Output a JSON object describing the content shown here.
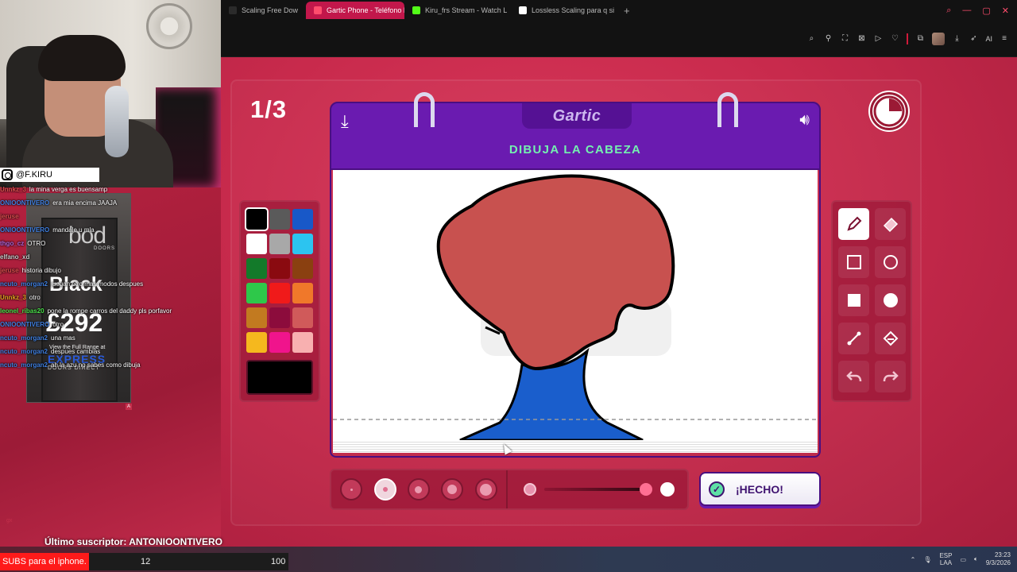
{
  "browser": {
    "tabs": [
      {
        "label": "Scaling Free Dow",
        "active": false,
        "icon": "page-icon",
        "color": "#2b2b2b"
      },
      {
        "label": "Gartic Phone - Teléfono D",
        "active": true,
        "icon": "phone-icon",
        "color": "#ff4d6d"
      },
      {
        "label": "Kiru_frs Stream - Watch L",
        "active": false,
        "icon": "kick-icon",
        "color": "#53fc18"
      },
      {
        "label": "Lossless Scaling para q si",
        "active": false,
        "icon": "google-icon",
        "color": "#ffffff"
      }
    ],
    "toolbar_ai": "AI"
  },
  "game": {
    "round": "1/3",
    "logo": "Gartic",
    "instruction": "DIBUJA LA CABEZA",
    "done_label": "¡HECHO!",
    "timer_elapsed_fraction": 0.25,
    "palette": [
      "#000000",
      "#5a5a5a",
      "#1858c8",
      "#ffffff",
      "#a8a8a8",
      "#2cc4f0",
      "#137a2a",
      "#8a0a10",
      "#8a4010",
      "#2ec84a",
      "#f01a1a",
      "#f0782a",
      "#c27a20",
      "#8c0c3c",
      "#d05a5a",
      "#f5b81e",
      "#f0148c",
      "#f8b0b0"
    ],
    "selected_color": "#000000",
    "brush_sizes": 5,
    "selected_brush": 2,
    "tools": [
      "pen-icon",
      "eraser-icon",
      "rect-outline-icon",
      "circle-outline-icon",
      "rect-fill-icon",
      "circle-fill-icon",
      "line-icon",
      "bucket-icon",
      "undo-icon",
      "redo-icon"
    ],
    "selected_tool": "pen-icon",
    "opacity_fraction": 1.0
  },
  "stream": {
    "social_handle": "@F.KIRU",
    "ad": {
      "brand": "bod",
      "brand_sub": "DOORS",
      "headline": "Black",
      "price": "£292",
      "range": "View the Full Range at",
      "express": "EXPRESS",
      "direct": "DOORS DIRECT",
      "tag": "A"
    },
    "chat": [
      {
        "user": "Unnkz_3",
        "msg": "la mina verga es buensamp",
        "color": "#e05050"
      },
      {
        "user": "ONIOONTIVERO",
        "msg": "era mia encima JAAJA",
        "color": "#3f7fe0"
      },
      {
        "user": "jeruse",
        "msg": "",
        "color": "#e05050"
      },
      {
        "user": "ONIOONTIVERO",
        "msg": "mandale u mla",
        "color": "#3f7fe0"
      },
      {
        "user": "thgo_cz",
        "msg": "OTRO",
        "color": "#b065d8"
      },
      {
        "user": "elfano_xd",
        "msg": "",
        "color": "#c9c9c9"
      },
      {
        "user": "jeruse",
        "msg": "historia dibujo",
        "color": "#e05050"
      },
      {
        "user": "ncuto_morgan2",
        "msg": "juegan otro mas modos despues",
        "color": "#3f7fe0"
      },
      {
        "user": "Unnkz_3",
        "msg": "otro",
        "color": "#e0a020"
      },
      {
        "user": "leonel_ribas20",
        "msg": "pone la rompe carros del daddy pls porfavor",
        "color": "#4ae04a"
      },
      {
        "user": "ONIOONTIVERO",
        "msg": "otro",
        "color": "#3f7fe0"
      },
      {
        "user": "ncuto_morgan2",
        "msg": "una mas",
        "color": "#3f7fe0"
      },
      {
        "user": "ncuto_morgan2",
        "msg": "despues cambias",
        "color": "#3f7fe0"
      },
      {
        "user": "ncuto_morgan2",
        "msg": "ah la azu no sabes como dibuja",
        "color": "#3f7fe0"
      }
    ],
    "subscriber": "Último suscriptor: ANTONIOONTIVERO",
    "corner_tag": "gx"
  },
  "taskbar": {
    "subs_label": "SUBS para el iphone.",
    "subs_current": "12",
    "subs_goal": "100",
    "lang_1": "ESP",
    "lang_2": "LAA",
    "time": "23:23",
    "date": "9/3/2026"
  }
}
